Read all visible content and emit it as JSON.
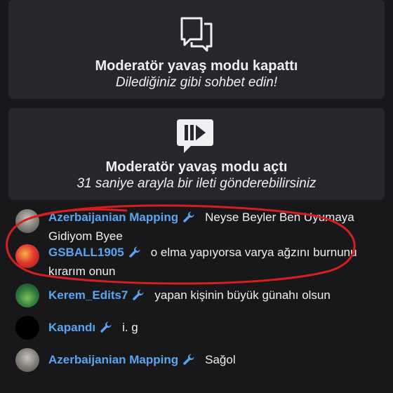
{
  "notices": [
    {
      "icon": "chat-bubbles-icon",
      "title": "Moderatör yavaş modu kapattı",
      "subtitle": "Dilediğiniz gibi sohbet edin!"
    },
    {
      "icon": "slow-mode-icon",
      "title": "Moderatör yavaş modu açtı",
      "subtitle": "31 saniye arayla bir ileti gönderebilirsiniz"
    }
  ],
  "messages": [
    {
      "user": "Azerbaijanian Mapping",
      "text": "Neyse Beyler Ben Uyumaya Gidiyom Byee"
    },
    {
      "user": "GSBALL1905",
      "text": "o elma yapıyorsa varya ağzını burnunu kırarım onun"
    },
    {
      "user": "Kerem_Edits7",
      "text": "yapan kişinin büyük günahı olsun"
    },
    {
      "user": "Kapandı",
      "text": "i. g"
    },
    {
      "user": "Azerbaijanian Mapping",
      "text": "Sağol"
    }
  ],
  "colors": {
    "background": "#18181b",
    "card": "#26262b",
    "username": "#59a5f0",
    "annotation": "#d41f1f"
  }
}
